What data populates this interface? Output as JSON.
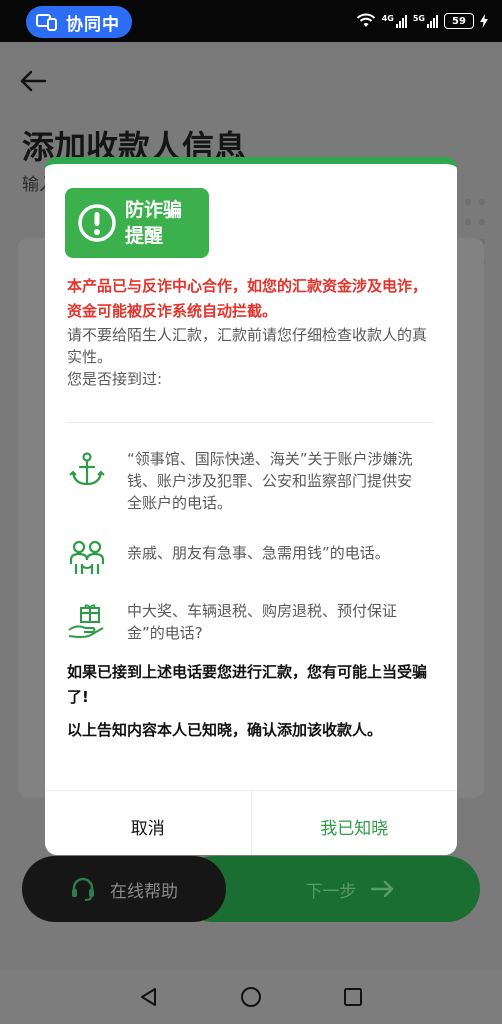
{
  "status_bar": {
    "collab_label": "协同中",
    "battery": "59",
    "net_a": "4G",
    "net_b": "5G"
  },
  "page": {
    "title": "添加收款人信息",
    "subtitle": "输入"
  },
  "bottom": {
    "help_label": "在线帮助",
    "next_label": "下一步"
  },
  "modal": {
    "badge_text": "防诈骗提醒",
    "warning": "本产品已与反诈中心合作，如您的汇款资金涉及电诈，资金可能被反诈系统自动拦截。",
    "intro": "请不要给陌生人汇款，汇款前请您仔细检查收款人的真实性。",
    "ask": "您是否接到过:",
    "items": [
      {
        "icon": "anchor-icon",
        "text": "“领事馆、国际快递、海关”关于账户涉嫌洗钱、账户涉及犯罪、公安和监察部门提供安全账户的电话。"
      },
      {
        "icon": "family-icon",
        "text": "亲戚、朋友有急事、急需用钱”的电话。"
      },
      {
        "icon": "gift-hand-icon",
        "text": "中大奖、车辆退税、购房退税、预付保证金”的电话?"
      }
    ],
    "caution": "如果已接到上述电话要您进行汇款，您有可能上当受骗了!",
    "acknowledge": "以上告知内容本人已知晓，确认添加该收款人。",
    "cancel_label": "取消",
    "confirm_label": "我已知晓"
  },
  "colors": {
    "accent_green": "#2ea84d",
    "warning_red": "#e2342b",
    "collab_blue": "#2c6df5"
  }
}
